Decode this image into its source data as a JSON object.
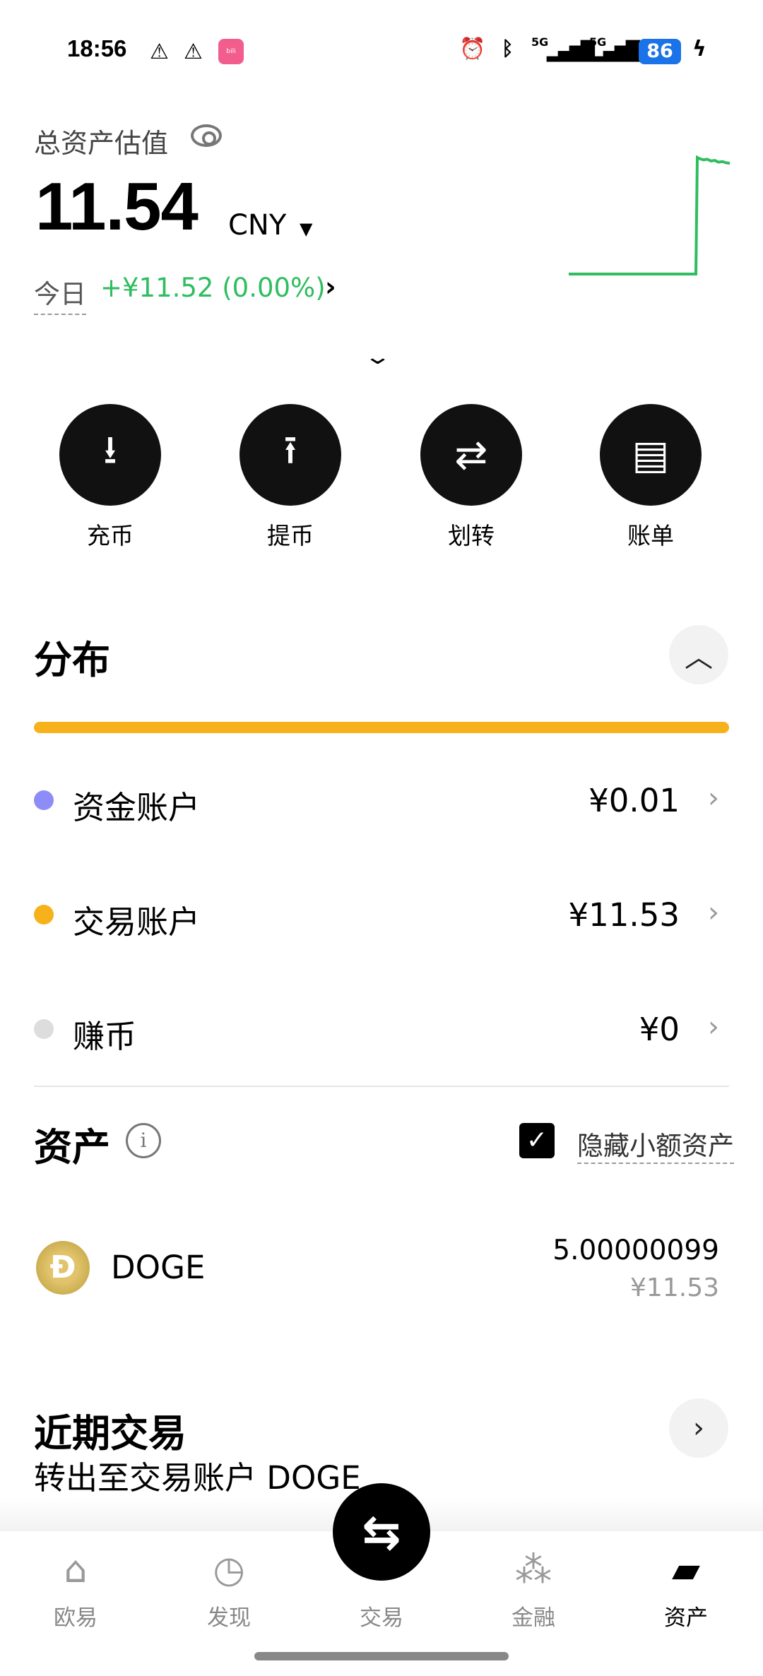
{
  "status_bar": {
    "time": "18:56",
    "battery": "86",
    "network1": "5G",
    "network2": "5G"
  },
  "header": {
    "title": "总资产估值",
    "total": "11.54",
    "currency": "CNY",
    "today_label": "今日",
    "today_pnl": "+¥11.52 (0.00%)",
    "pnl_color": "#2ebd5f",
    "sparkline": [
      0,
      0,
      0,
      0,
      0,
      0,
      0,
      0,
      0,
      0,
      1,
      0.99,
      0.98,
      0.985,
      0.97,
      0.975,
      0.96,
      0.965,
      0.955,
      0.95
    ]
  },
  "actions": [
    {
      "label": "充币",
      "icon": "deposit-icon"
    },
    {
      "label": "提币",
      "icon": "withdraw-icon"
    },
    {
      "label": "划转",
      "icon": "transfer-icon"
    },
    {
      "label": "账单",
      "icon": "bill-icon"
    }
  ],
  "distribution": {
    "title": "分布",
    "bar_color": "#f7b21b",
    "accounts": [
      {
        "label": "资金账户",
        "amount": "¥0.01",
        "color": "#8e8cf8"
      },
      {
        "label": "交易账户",
        "amount": "¥11.53",
        "color": "#f7b21b"
      },
      {
        "label": "赚币",
        "amount": "¥0",
        "color": "#dddddd"
      }
    ]
  },
  "assets": {
    "title": "资产",
    "hide_small_label": "隐藏小额资产",
    "hide_small_checked": true,
    "items": [
      {
        "symbol": "DOGE",
        "quantity": "5.00000099",
        "value": "¥11.53"
      }
    ]
  },
  "recent": {
    "title": "近期交易",
    "first_item": "转出至交易账户 DOGE"
  },
  "nav": {
    "items": [
      {
        "label": "欧易",
        "icon": "home-icon"
      },
      {
        "label": "发现",
        "icon": "discover-icon"
      },
      {
        "label": "交易",
        "icon": "trade-icon"
      },
      {
        "label": "金融",
        "icon": "finance-icon"
      },
      {
        "label": "资产",
        "icon": "wallet-icon",
        "active": true
      }
    ]
  }
}
